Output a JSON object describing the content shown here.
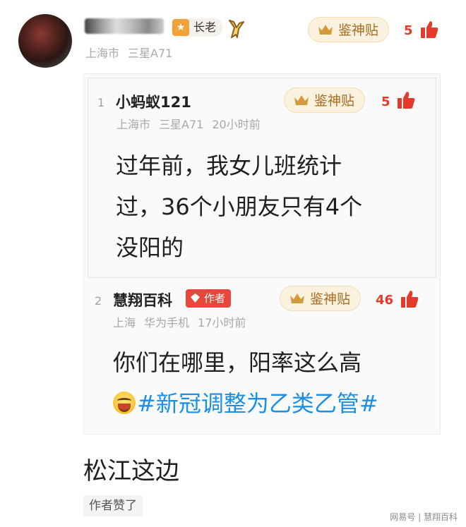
{
  "header": {
    "level_badge": "长老",
    "level_icon": "★",
    "location": "上海市",
    "device": "三星A71",
    "god_label": "鉴神贴",
    "likes": "5"
  },
  "quotes": [
    {
      "index": "1",
      "username": "小蚂蚁121",
      "location": "上海市",
      "device": "三星A71",
      "time": "20小时前",
      "god_label": "鉴神贴",
      "likes": "5",
      "content_lines": [
        "过年前，我女儿班统计",
        "过，36个小朋友只有4个",
        "没阳的"
      ]
    },
    {
      "index": "2",
      "username": "慧翔百科",
      "author_tag": "作者",
      "location": "上海",
      "device": "华为手机",
      "time": "17小时前",
      "god_label": "鉴神贴",
      "likes": "46",
      "content_line1": "你们在哪里，阳率这么高",
      "hashtag": "#新冠调整为乙类乙管#"
    }
  ],
  "reply": {
    "text": "松江这边",
    "author_liked": "作者赞了"
  },
  "watermark": {
    "site": "网易号",
    "account": "慧翔百科"
  },
  "colors": {
    "accent_red": "#e33a2b",
    "hashtag_blue": "#1a8fe8",
    "gold": "#a86c22"
  }
}
